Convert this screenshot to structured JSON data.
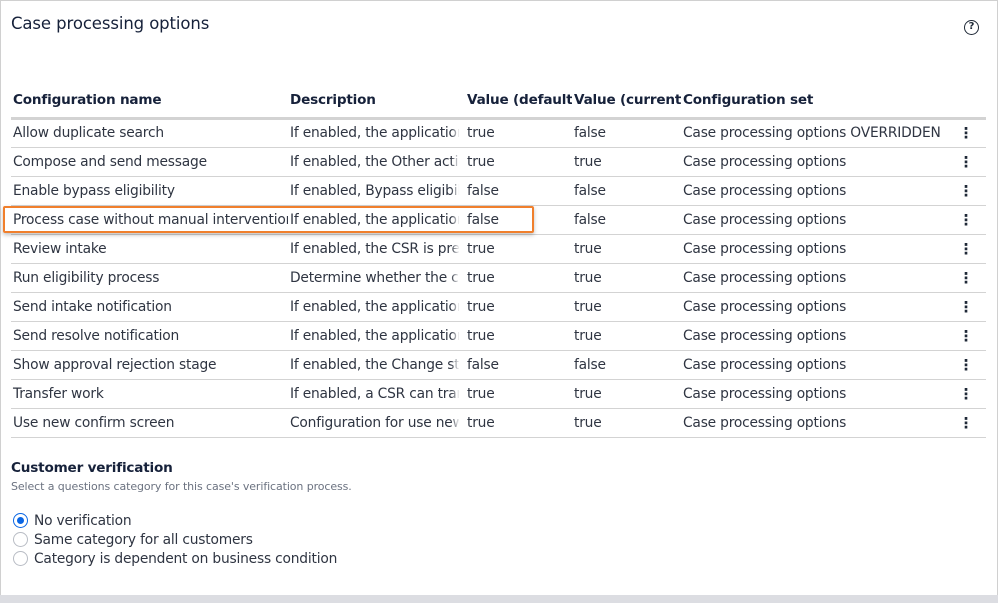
{
  "header": {
    "title": "Case processing options",
    "help_icon": "?"
  },
  "table": {
    "columns": [
      "Configuration name",
      "Description",
      "Value (default)",
      "Value (current)",
      "Configuration set"
    ],
    "rows": [
      {
        "name": "Allow duplicate search",
        "description": "If enabled, the application",
        "default": "true",
        "current": "false",
        "set": "Case processing options OVERRIDDEN",
        "overridden": true
      },
      {
        "name": "Compose and send message",
        "description": "If enabled, the Other actions",
        "default": "true",
        "current": "true",
        "set": "Case processing options",
        "overridden": false
      },
      {
        "name": "Enable bypass eligibility",
        "description": "If enabled, Bypass eligibility",
        "default": "false",
        "current": "false",
        "set": "Case processing options",
        "overridden": false
      },
      {
        "name": "Process case without manual intervention",
        "description": "If enabled, the application",
        "default": "false",
        "current": "false",
        "set": "Case processing options",
        "overridden": false
      },
      {
        "name": "Review intake",
        "description": "If enabled, the CSR is presented",
        "default": "true",
        "current": "true",
        "set": "Case processing options",
        "overridden": false
      },
      {
        "name": "Run eligibility process",
        "description": "Determine whether the case",
        "default": "true",
        "current": "true",
        "set": "Case processing options",
        "overridden": false
      },
      {
        "name": "Send intake notification",
        "description": "If enabled, the application",
        "default": "true",
        "current": "true",
        "set": "Case processing options",
        "overridden": false
      },
      {
        "name": "Send resolve notification",
        "description": "If enabled, the application",
        "default": "true",
        "current": "true",
        "set": "Case processing options",
        "overridden": false
      },
      {
        "name": "Show approval rejection stage",
        "description": "If enabled, the Change stage",
        "default": "false",
        "current": "false",
        "set": "Case processing options",
        "overridden": false
      },
      {
        "name": "Transfer work",
        "description": "If enabled, a CSR can transfer",
        "default": "true",
        "current": "true",
        "set": "Case processing options",
        "overridden": false
      },
      {
        "name": "Use new confirm screen",
        "description": "Configuration for use new",
        "default": "true",
        "current": "true",
        "set": "Case processing options",
        "overridden": false
      }
    ],
    "highlighted_row": "Process case without manual intervention",
    "row_menu_icon": "⋮",
    "reset_icon": "↻"
  },
  "verification": {
    "title": "Customer verification",
    "subtitle": "Select a questions category for this case's verification process.",
    "options": [
      {
        "label": "No verification",
        "selected": true
      },
      {
        "label": "Same category for all customers",
        "selected": false
      },
      {
        "label": "Category is dependent on business condition",
        "selected": false
      }
    ]
  },
  "colors": {
    "highlight_border": "#f07f2c",
    "radio_selected": "#0a66e4"
  }
}
